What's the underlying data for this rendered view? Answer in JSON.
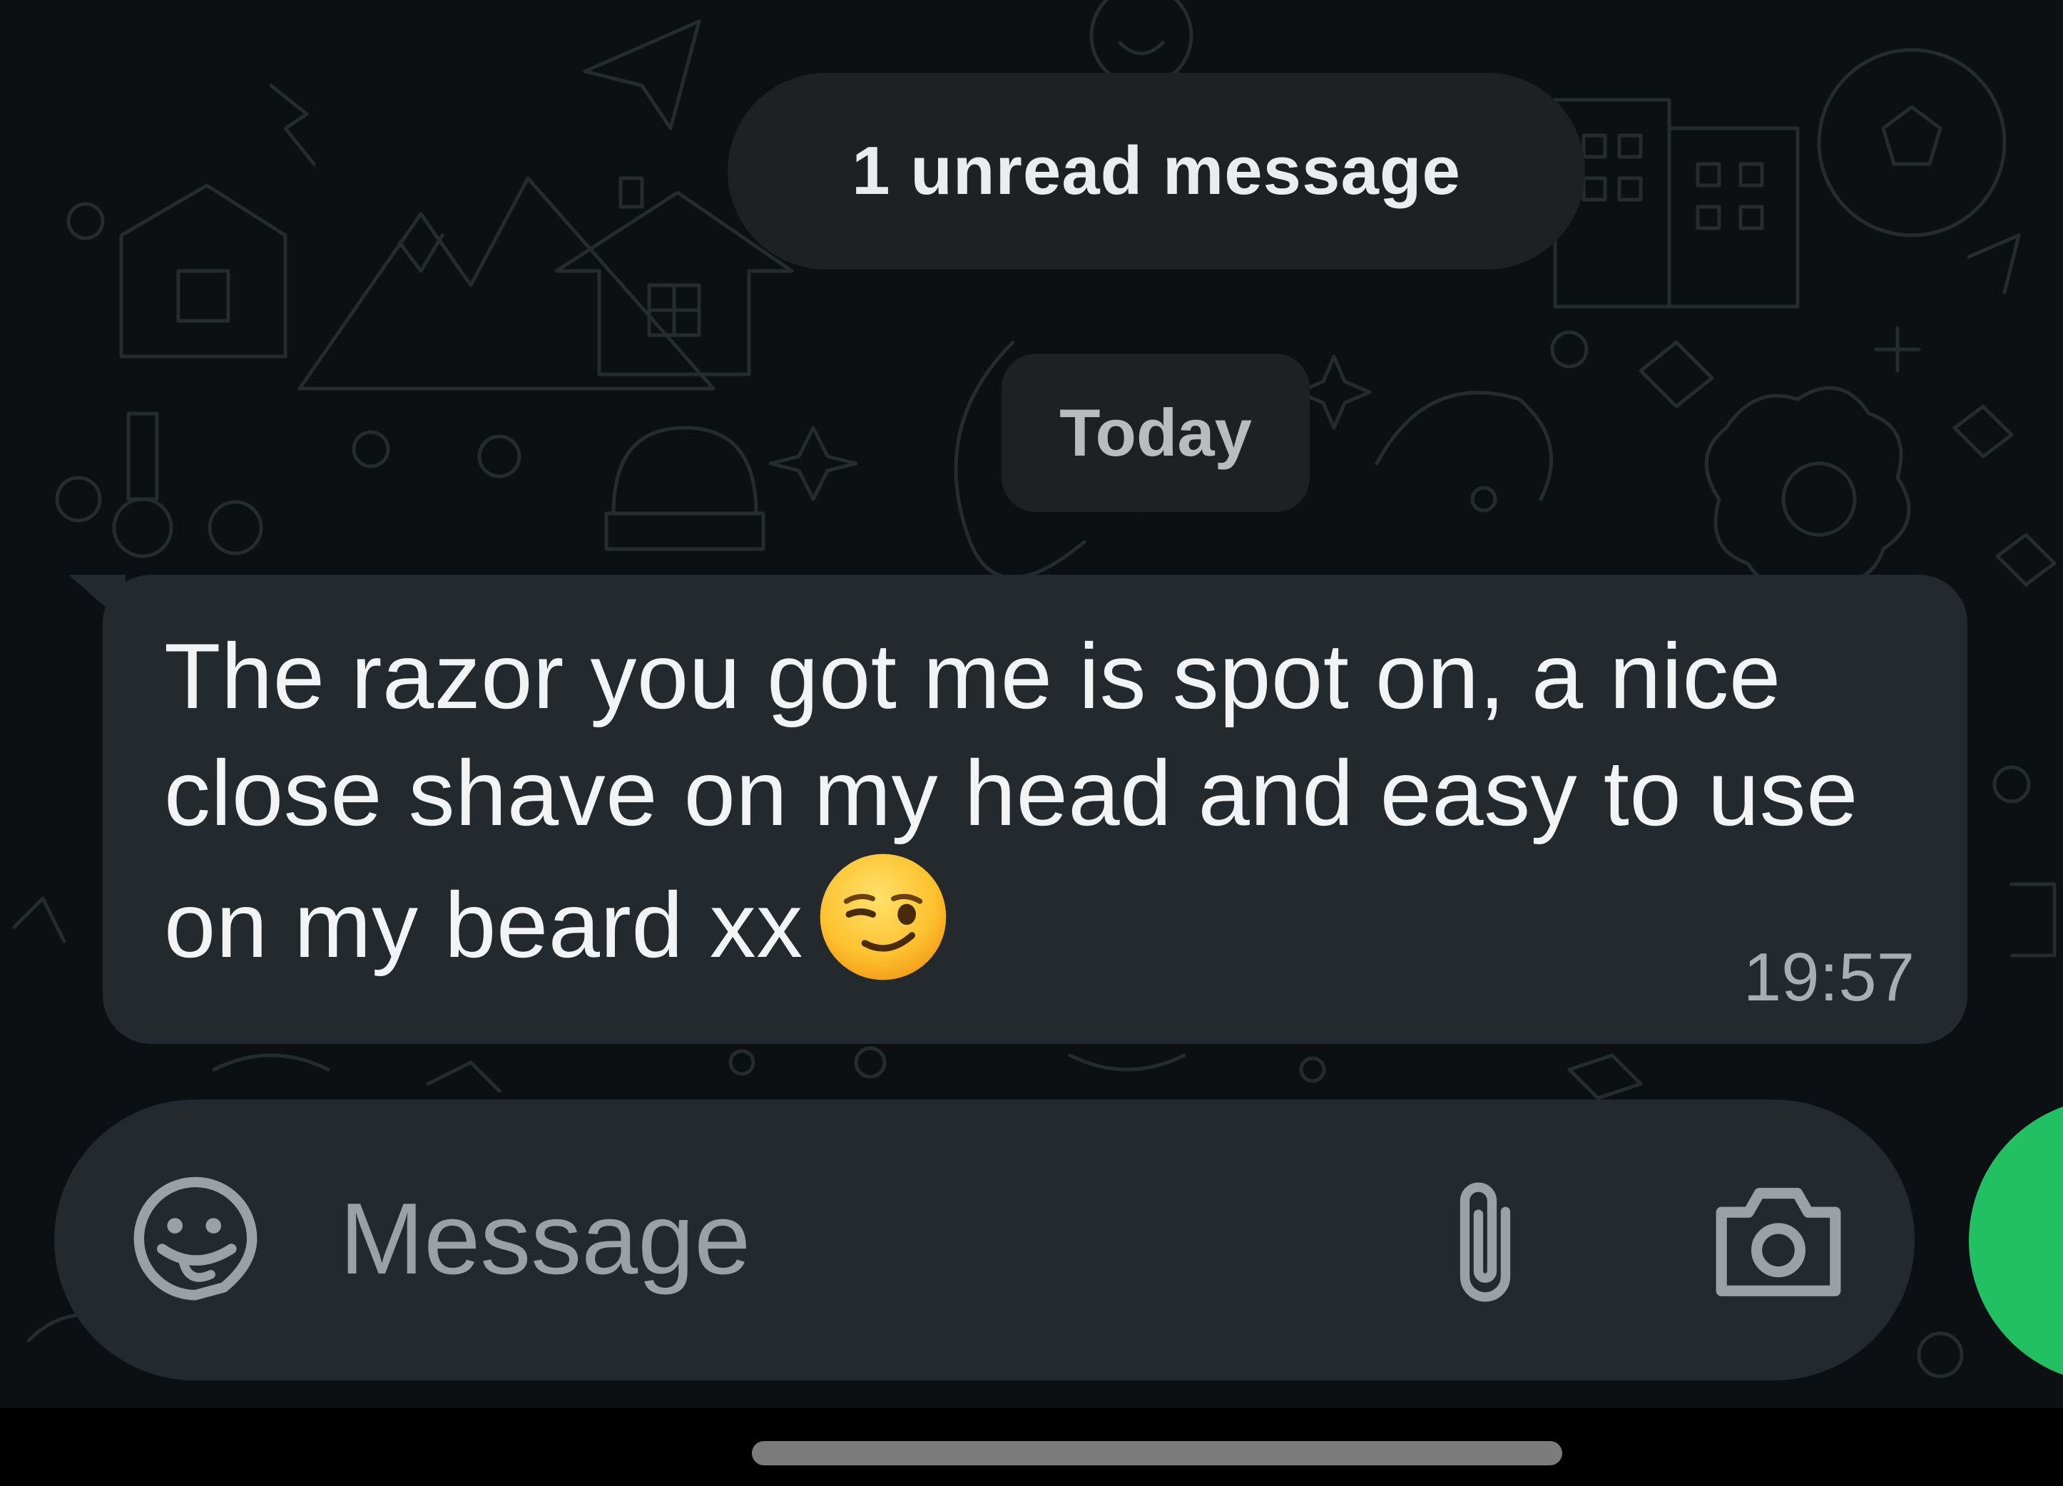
{
  "chat": {
    "unread_banner": "1 unread message",
    "date_chip": "Today",
    "message": {
      "text": "The razor you got me is spot on, a nice close shave on my head and easy to use on my beard xx",
      "emoji": "smirking-face",
      "time": "19:57",
      "direction": "incoming"
    }
  },
  "composer": {
    "placeholder": "Message",
    "emoji_icon": "sticker-emoji-icon",
    "attach_icon": "paperclip-icon",
    "camera_icon": "camera-icon"
  },
  "colors": {
    "background": "#0d1012",
    "bubble": "#23292d",
    "text": "#f1f3f4",
    "muted_text": "#a8adb1",
    "send_button": "#21c063"
  }
}
